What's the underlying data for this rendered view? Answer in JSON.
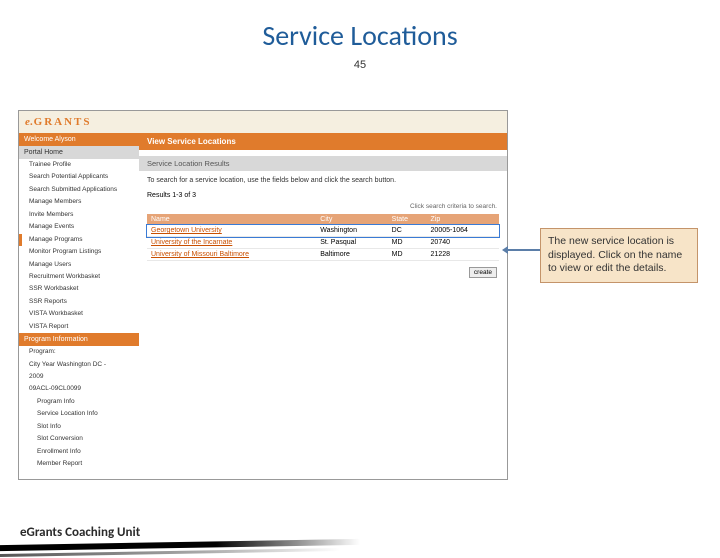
{
  "slide": {
    "title": "Service Locations",
    "number": "45",
    "footer": "eGrants Coaching Unit"
  },
  "brand": {
    "e": "e.",
    "rest": "GRANTS"
  },
  "sidebar": {
    "welcome": "Welcome Alyson",
    "portal_home": "Portal Home",
    "items": [
      "Trainee Profile",
      "Search Potential Applicants",
      "Search Submitted Applications",
      "Manage Members",
      "Invite Members",
      "Manage Events"
    ],
    "manage_programs": "Manage Programs",
    "items2": [
      "Monitor Program Listings",
      "Manage Users",
      "Recruitment Workbasket",
      "SSR Workbasket",
      "SSR Reports",
      "VISTA Workbasket",
      "VISTA Report"
    ],
    "program_info": "Program Information",
    "program_label": "Program:",
    "program_lines": [
      "City Year Washington DC -",
      "2009",
      "09ACL-09CL0099"
    ],
    "program_sub": [
      "Program Info",
      "Service Location Info",
      "Slot Info",
      "Slot Conversion",
      "Enrollment Info",
      "Member Report"
    ]
  },
  "main": {
    "page_title": "View Service Locations",
    "panel_title": "Service Location Results",
    "instructions": "To search for a service location, use the fields below and click the search button.",
    "results_label": "Results 1-3 of 3",
    "search_note": "Click search criteria to search.",
    "columns": {
      "name": "Name",
      "city": "City",
      "state": "State",
      "zip": "Zip"
    },
    "rows": [
      {
        "name": "Georgetown University",
        "city": "Washington",
        "state": "DC",
        "zip": "20005-1064"
      },
      {
        "name": "University of the Incarnate",
        "city": "St. Pasqual",
        "state": "MD",
        "zip": "20740"
      },
      {
        "name": "University of Missouri Baltimore",
        "city": "Baltimore",
        "state": "MD",
        "zip": "21228"
      }
    ],
    "create_btn": "create"
  },
  "callout": "The new service location is displayed. Click on the name to view or edit the details."
}
